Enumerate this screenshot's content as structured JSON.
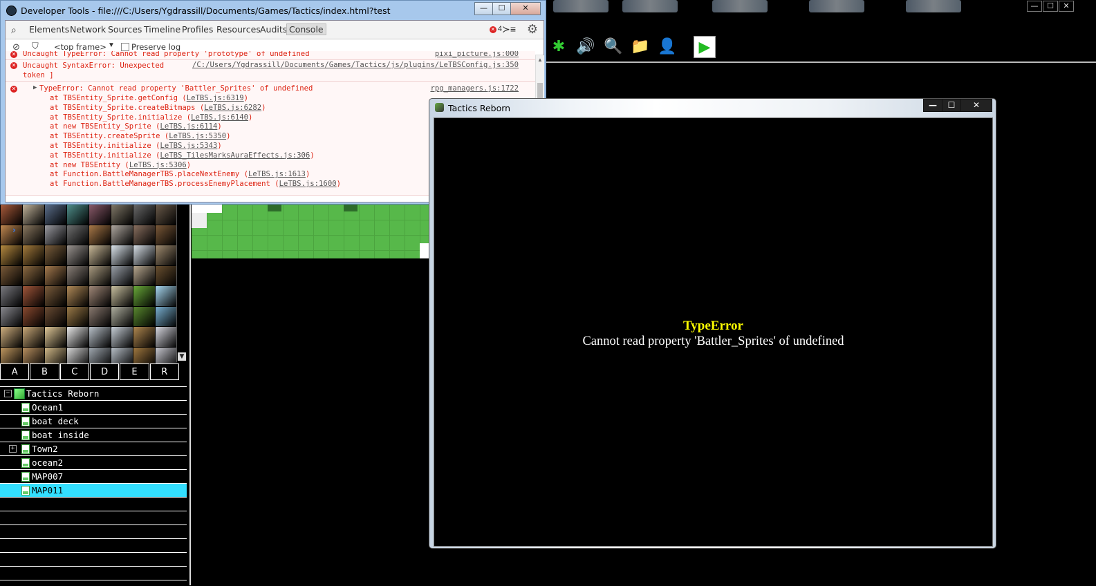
{
  "devtools": {
    "title": "Developer Tools - file:///C:/Users/Ygdrassill/Documents/Games/Tactics/index.html?test",
    "window_buttons": [
      "—",
      "☐",
      "✕"
    ],
    "tabs": [
      "Elements",
      "Network",
      "Sources",
      "Timeline",
      "Profiles",
      "Resources",
      "Audits",
      "Console"
    ],
    "active_tab": "Console",
    "error_count": "4",
    "console_toolbar": {
      "frame": "<top frame>",
      "preserve_log": "Preserve log",
      "preserve_checked": false
    },
    "log": {
      "partial_line": "Uncaught TypeError: Cannot read property 'prototype' of undefined",
      "partial_src": "pixi_picture.js:000",
      "syntax_error": {
        "message": "Uncaught SyntaxError: Unexpected\ntoken ]",
        "source": "/C:/Users/Ygdrassill/Documents/Games/Tactics/js/plugins/LeTBSConfig.js:350"
      },
      "type_error": {
        "message": "TypeError: Cannot read property 'Battler_Sprites' of undefined",
        "source": "rpg_managers.js:1722"
      },
      "stack": [
        {
          "fn": "at TBSEntity_Sprite.getConfig (",
          "loc": "LeTBS.js:6319",
          "end": ")"
        },
        {
          "fn": "at TBSEntity_Sprite.createBitmaps (",
          "loc": "LeTBS.js:6282",
          "end": ")"
        },
        {
          "fn": "at TBSEntity_Sprite.initialize (",
          "loc": "LeTBS.js:6140",
          "end": ")"
        },
        {
          "fn": "at new TBSEntity_Sprite (",
          "loc": "LeTBS.js:6114",
          "end": ")"
        },
        {
          "fn": "at TBSEntity.createSprite (",
          "loc": "LeTBS.js:5350",
          "end": ")"
        },
        {
          "fn": "at TBSEntity.initialize (",
          "loc": "LeTBS.js:5343",
          "end": ")"
        },
        {
          "fn": "at TBSEntity.initialize (",
          "loc": "LeTBS_TilesMarksAuraEffects.js:306",
          "end": ")"
        },
        {
          "fn": "at new TBSEntity (",
          "loc": "LeTBS.js:5306",
          "end": ")"
        },
        {
          "fn": "at Function.BattleManagerTBS.placeNextEnemy (",
          "loc": "LeTBS.js:1613",
          "end": ")"
        },
        {
          "fn": "at Function.BattleManagerTBS.processEnemyPlacement (",
          "loc": "LeTBS.js:1600",
          "end": ")"
        }
      ],
      "prompt": "›"
    }
  },
  "game_window": {
    "title": "Tactics Reborn",
    "window_buttons": [
      "—",
      "☐",
      "✕"
    ],
    "error_title": "TypeError",
    "error_message": "Cannot read property 'Battler_Sprites' of undefined"
  },
  "editor": {
    "window_buttons": [
      "—",
      "☐",
      "✕"
    ],
    "toolbar_icons": [
      "plugin-manager-icon",
      "sound-test-icon",
      "event-searcher-icon",
      "resource-manager-icon",
      "character-generator-icon",
      "playtest-icon"
    ],
    "tileset_tabs": [
      "A",
      "B",
      "C",
      "D",
      "E",
      "R"
    ],
    "map_tree": {
      "project": "Tactics Reborn",
      "maps": [
        "Ocean1",
        "boat deck",
        "boat inside",
        "Town2",
        "ocean2",
        "MAP007",
        "MAP011"
      ],
      "selected": "MAP011",
      "expandable": [
        "Town2"
      ]
    },
    "colors": {
      "selection": "#33dfff",
      "grass": "#57b84a",
      "error_title": "#ffff00",
      "console_error": "#d21"
    }
  }
}
